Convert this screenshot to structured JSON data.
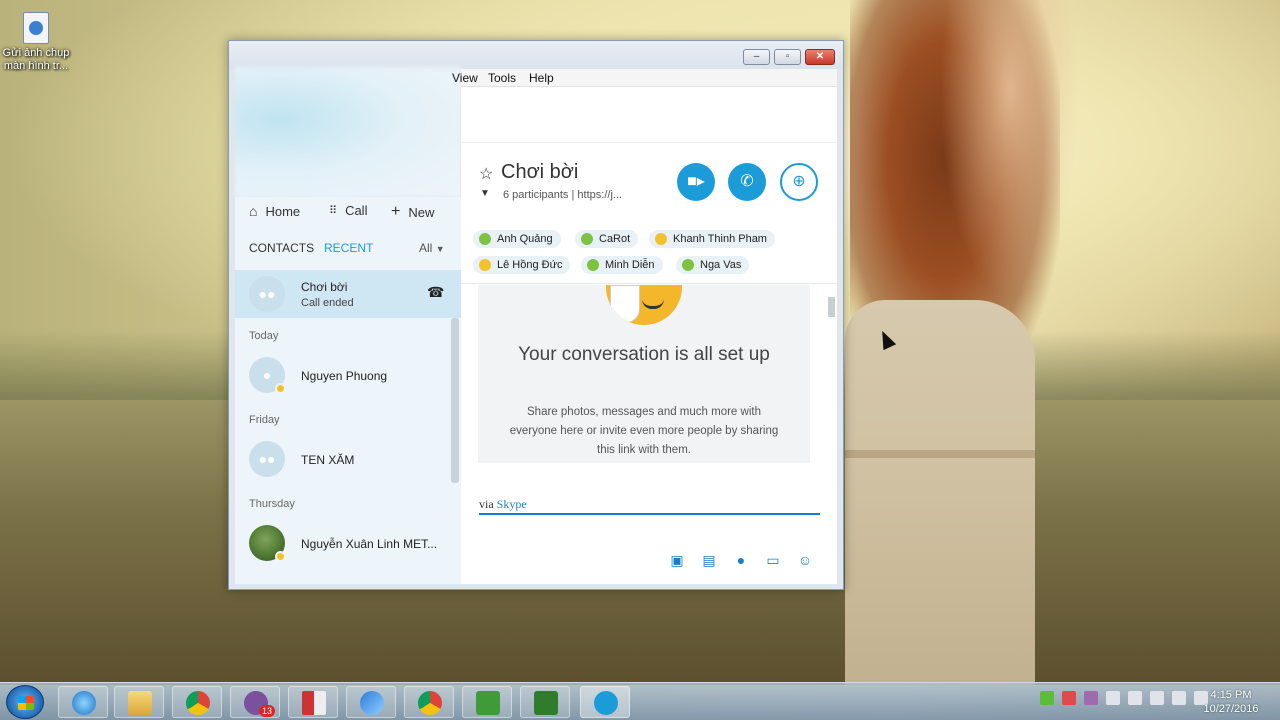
{
  "desktop": {
    "icon_label": "Gửi ảnh chụp màn hình tr..."
  },
  "window": {
    "menu": {
      "view": "View",
      "tools": "Tools",
      "help": "Help"
    }
  },
  "sidebar": {
    "nav": {
      "home": "Home",
      "call": "Call",
      "new": "New"
    },
    "tabs": {
      "contacts": "CONTACTS",
      "recent": "RECENT",
      "filter": "All"
    },
    "active_item": {
      "name": "Chơi bời",
      "status": "Call ended"
    },
    "sections": {
      "today": "Today",
      "friday": "Friday",
      "thursday": "Thursday"
    },
    "contacts": [
      {
        "name": "Nguyen Phuong"
      },
      {
        "name": "TEN XĂM"
      },
      {
        "name": "Nguyễn Xuân Linh MET..."
      }
    ]
  },
  "chat": {
    "title": "Chơi bời",
    "participants": "6 participants",
    "link": "https://j...",
    "participant_chips": [
      {
        "name": "Anh Quảng",
        "status": "online"
      },
      {
        "name": "CaRot",
        "status": "online"
      },
      {
        "name": "Khanh Thinh Pham",
        "status": "away"
      },
      {
        "name": "Lê Hồng Đức",
        "status": "away"
      },
      {
        "name": "Minh Diễn",
        "status": "online"
      },
      {
        "name": "Nga Vas",
        "status": "online"
      }
    ],
    "card": {
      "heading": "Your conversation is all set up",
      "body": "Share photos, messages and much more with everyone here or invite even more people by sharing this link with them."
    },
    "via_prefix": "via",
    "via_link": "Skype"
  },
  "taskbar": {
    "time": "4:15 PM",
    "date": "10/27/2016",
    "viber_badge": "13"
  },
  "colors": {
    "skype_blue": "#1b9bd8",
    "online": "#7dc243",
    "away": "#f2c12c",
    "selected_row": "#cfe6f3"
  }
}
